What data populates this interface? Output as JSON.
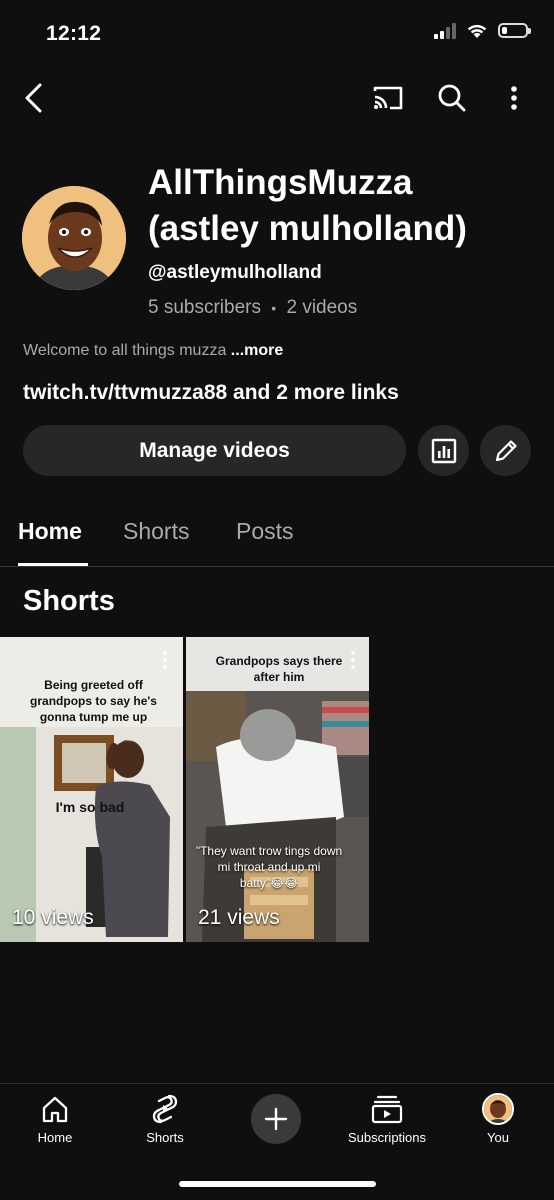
{
  "status_bar": {
    "time": "12:12"
  },
  "channel": {
    "name_line1": "AllThingsMuzza",
    "name_line2": "(astley mulholland)",
    "handle": "@astleymulholland",
    "subscribers": "5 subscribers",
    "separator": "•",
    "videos": "2 videos",
    "description": "Welcome to all things muzza",
    "description_more": "...more",
    "links": "twitch.tv/ttvmuzza88 and 2 more links"
  },
  "actions": {
    "manage_videos": "Manage videos"
  },
  "tabs": [
    {
      "label": "Home",
      "active": true
    },
    {
      "label": "Shorts",
      "active": false
    },
    {
      "label": "Posts",
      "active": false
    }
  ],
  "shorts_section": {
    "title": "Shorts",
    "items": [
      {
        "caption": "Being greeted off grandpops to say he's gonna tump me up",
        "overlay": "I'm so bad",
        "views": "10 views"
      },
      {
        "caption": "Grandpops says there after him",
        "overlay": "\"They want trow tings down mi throat and up mi batty\"😂😂",
        "views": "21 views"
      }
    ]
  },
  "bottom_nav": [
    {
      "label": "Home",
      "icon": "home-icon"
    },
    {
      "label": "Shorts",
      "icon": "shorts-icon"
    },
    {
      "label": "",
      "icon": "plus-icon"
    },
    {
      "label": "Subscriptions",
      "icon": "subscriptions-icon"
    },
    {
      "label": "You",
      "icon": "avatar"
    }
  ],
  "colors": {
    "background": "#0f0f0f",
    "button": "#272727",
    "secondary_text": "#aaaaaa"
  }
}
